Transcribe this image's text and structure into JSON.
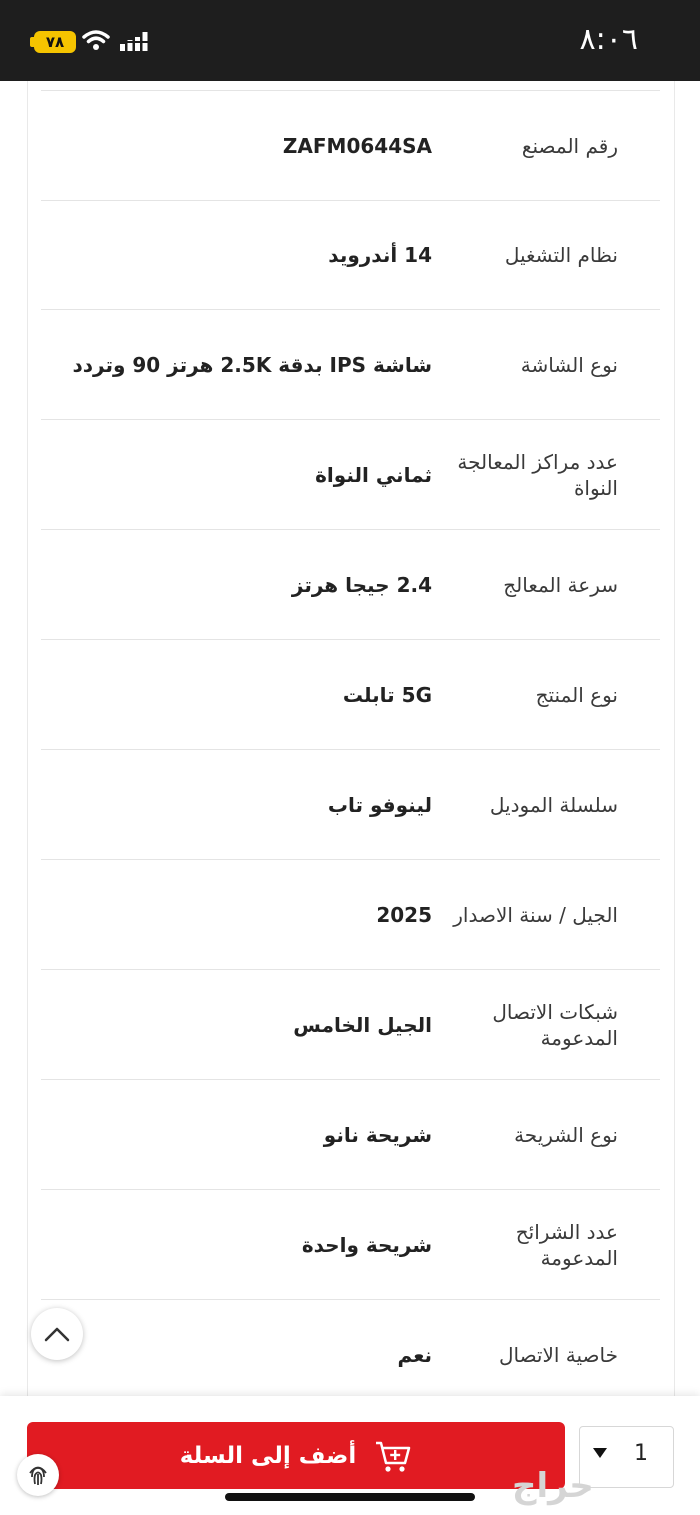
{
  "status_bar": {
    "time": "٨:٠٦",
    "battery": "٧٨"
  },
  "specs": [
    {
      "label": "رقم المصنع",
      "value": "ZAFM0644SA"
    },
    {
      "label": "نظام التشغيل",
      "value": "14 أندرويد"
    },
    {
      "label": "نوع الشاشة",
      "value": "شاشة IPS بدقة 2.5K هرتز 90 وتردد"
    },
    {
      "label": "عدد مراكز المعالجة النواة",
      "value": "ثماني النواة"
    },
    {
      "label": "سرعة المعالج",
      "value": "2.4 جيجا هرتز"
    },
    {
      "label": "نوع المنتج",
      "value": "5G تابلت"
    },
    {
      "label": "سلسلة الموديل",
      "value": "لينوفو تاب"
    },
    {
      "label": "الجيل / سنة الاصدار",
      "value": "2025"
    },
    {
      "label": "شبكات الاتصال المدعومة",
      "value": "الجيل الخامس"
    },
    {
      "label": "نوع الشريحة",
      "value": "شريحة نانو"
    },
    {
      "label": "عدد الشرائح المدعومة",
      "value": "شريحة واحدة"
    },
    {
      "label": "خاصية الاتصال",
      "value": "نعم"
    }
  ],
  "footer": {
    "add_to_cart_label": "أضف إلى السلة",
    "quantity": "1",
    "watermark": "حراج"
  },
  "icons": {
    "scroll_top": "chevron-up-icon",
    "cart": "cart-plus-icon",
    "quantity": "caret-down-icon",
    "fingerprint": "fingerprint-icon"
  },
  "colors": {
    "accent": "#e11b22",
    "battery": "#f5c400",
    "status_bar": "#1e1e1e"
  }
}
